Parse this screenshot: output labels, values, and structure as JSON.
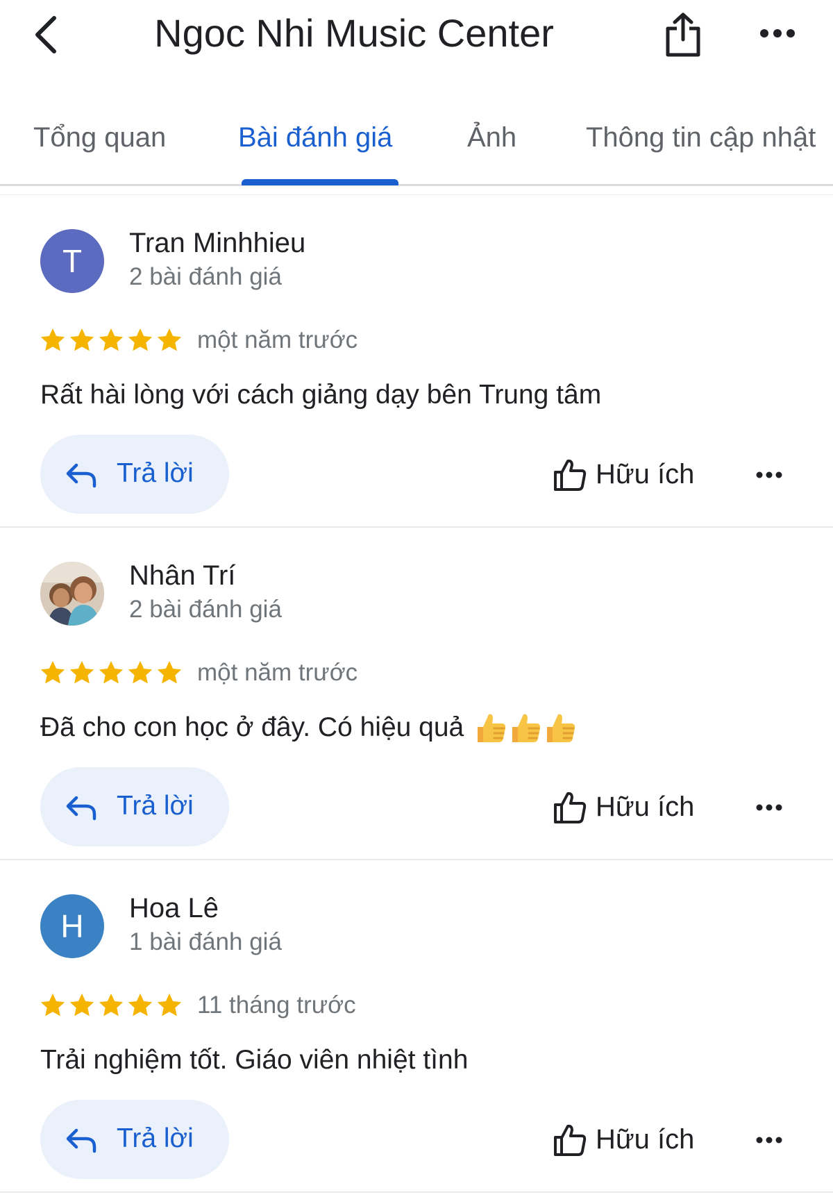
{
  "header": {
    "title": "Ngoc Nhi Music Center",
    "back_icon": "chevron-left-icon",
    "share_icon": "share-icon",
    "more_icon": "more-horizontal-icon"
  },
  "tabs": [
    {
      "label": "Tổng quan",
      "active": false
    },
    {
      "label": "Bài đánh giá",
      "active": true
    },
    {
      "label": "Ảnh",
      "active": false
    },
    {
      "label": "Thông tin cập nhật",
      "active": false
    }
  ],
  "colors": {
    "accent": "#1a5fd0",
    "star": "#f4b400",
    "reply_bg": "#eaf1fb"
  },
  "reviews": [
    {
      "avatar_letter": "T",
      "avatar_color": "#5c6bc0",
      "name": "Tran Minhhieu",
      "review_count": "2 bài đánh giá",
      "rating": 5,
      "date": "một năm trước",
      "text": "Rất hài lòng với cách giảng dạy bên Trung tâm",
      "reply_label": "Trả lời",
      "helpful_label": "Hữu ích"
    },
    {
      "avatar_letter": "",
      "avatar_color": "#b08a6a",
      "name": "Nhân Trí",
      "review_count": "2 bài đánh giá",
      "rating": 5,
      "date": "một năm trước",
      "text": "Đã cho con học ở đây. Có hiệu quả",
      "reply_label": "Trả lời",
      "helpful_label": "Hữu ích"
    },
    {
      "avatar_letter": "H",
      "avatar_color": "#3b82c4",
      "name": "Hoa Lê",
      "review_count": "1 bài đánh giá",
      "rating": 5,
      "date": "11 tháng trước",
      "text": "Trải nghiệm tốt. Giáo viên nhiệt tình",
      "reply_label": "Trả lời",
      "helpful_label": "Hữu ích"
    }
  ]
}
